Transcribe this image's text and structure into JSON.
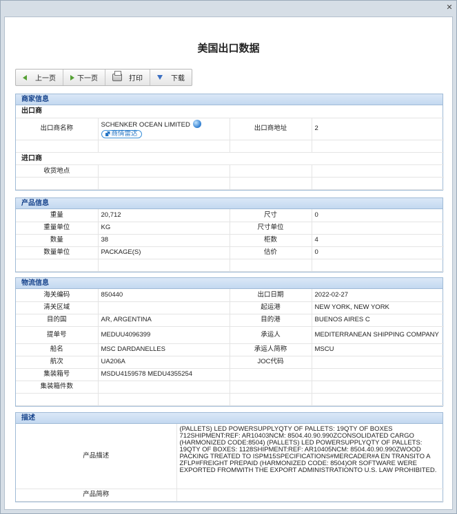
{
  "window": {
    "close_glyph": "✕"
  },
  "page": {
    "title": "美国出口数据"
  },
  "toolbar": {
    "prev": "上一页",
    "next": "下一页",
    "print": "打印",
    "download": "下载"
  },
  "merchant": {
    "heading": "商家信息",
    "exporter_group": "出口商",
    "exporter_name_label": "出口商名称",
    "exporter_name": "SCHENKER OCEAN LIMITED",
    "radar_link": "商情雷达",
    "exporter_address_label": "出口商地址",
    "exporter_address": "2",
    "importer_group": "进口商",
    "delivery_label": "收货地点"
  },
  "product": {
    "heading": "产品信息",
    "weight_label": "重量",
    "weight": "20,712",
    "size_label": "尺寸",
    "size": "0",
    "weight_unit_label": "重量单位",
    "weight_unit": "KG",
    "size_unit_label": "尺寸单位",
    "quantity_label": "数量",
    "quantity": "38",
    "containers_label": "柜数",
    "containers": "4",
    "quantity_unit_label": "数量单位",
    "quantity_unit": "PACKAGE(S)",
    "estimate_label": "估价",
    "estimate": "0"
  },
  "logistics": {
    "heading": "物流信息",
    "hs_code_label": "海关编码",
    "hs_code": "850440",
    "export_date_label": "出口日期",
    "export_date": "2022-02-27",
    "customs_area_label": "清关区域",
    "origin_port_label": "起运港",
    "origin_port": "NEW YORK, NEW YORK",
    "dest_country_label": "目的国",
    "dest_country": "AR, ARGENTINA",
    "dest_port_label": "目的港",
    "dest_port": "BUENOS AIRES C",
    "bill_label": "提单号",
    "bill": "MEDUU4096399",
    "carrier_label": "承运人",
    "carrier": "MEDITERRANEAN SHIPPING COMPANY",
    "vessel_label": "船名",
    "vessel": "MSC DARDANELLES",
    "carrier_abbr_label": "承运人简称",
    "carrier_abbr": "MSCU",
    "voyage_label": "航次",
    "voyage": "UA206A",
    "joc_label": "JOC代码",
    "container_no_label": "集装箱号",
    "container_no": "MSDU4159578 MEDU4355254",
    "container_pieces_label": "集装箱件数"
  },
  "description": {
    "heading": "描述",
    "desc_label": "产品描述",
    "desc": "(PALLETS) LED POWERSUPPLYQTY OF PALLETS: 19QTY OF BOXES 712SHIPMENT:REF: AR10403NCM: 8504.40.90.990ZCONSOLIDATED CARGO (HARMONIZED CODE:8504) (PALLETS) LED POWERSUPPLYQTY OF PALLETS: 19QTY OF BOXES: 1128SHIPMENT:REF: AR10405NCM: 8504.40.90.990ZWOOD PACKING TREATED TO ISPM15SPECIFICATIONS#MERCADER#A EN TRANSITO A ZFLP#FREIGHT PREPAID (HARMONIZED CODE: 8504)OR SOFTWARE WERE EXPORTED FROMWITH THE EXPORT ADMINISTRATIONTO U.S. LAW PROHIBITED.",
    "short_label": "产品简称"
  }
}
